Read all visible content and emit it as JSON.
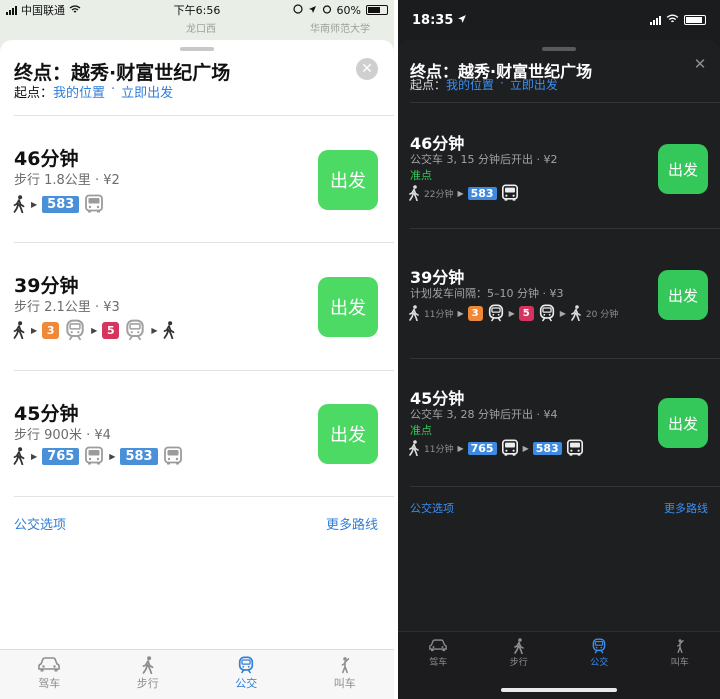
{
  "colors": {
    "accent": "#2f7ed8",
    "go": "#4cd964",
    "bus": "#4a90d9",
    "line3": "#f0883a",
    "line5": "#d6345f",
    "ontime": "#35c759"
  },
  "left": {
    "status": {
      "carrier": "中国联通",
      "time": "下午6:56",
      "battery": "60%"
    },
    "map_labels": [
      "龙口西",
      "华南师范大学"
    ],
    "header": {
      "destination": "终点：越秀·财富世纪广场",
      "origin_label": "起点：",
      "origin_value": "我的位置",
      "sep": "·",
      "depart": "立即出发"
    },
    "routes": [
      {
        "duration": "46分钟",
        "info": "步行 1.8公里 · ¥2",
        "bus1": "583",
        "go": "出发"
      },
      {
        "duration": "39分钟",
        "info": "步行 2.1公里 · ¥3",
        "line1": "3",
        "line2": "5",
        "go": "出发"
      },
      {
        "duration": "45分钟",
        "info": "步行 900米 · ¥4",
        "bus1": "765",
        "bus2": "583",
        "go": "出发"
      }
    ],
    "footer": {
      "options": "公交选项",
      "more": "更多路线"
    },
    "tabs": [
      "驾车",
      "步行",
      "公交",
      "叫车"
    ]
  },
  "right": {
    "status": {
      "time": "18:35"
    },
    "header": {
      "destination": "终点：越秀·财富世纪广场",
      "origin_label": "起点：",
      "origin_value": "我的位置",
      "sep": "·",
      "depart": "立即出发"
    },
    "routes": [
      {
        "duration": "46分钟",
        "info": "公交车 3, 15 分钟后开出 · ¥2",
        "ontime": "准点",
        "walk1": "22分钟",
        "bus1": "583",
        "go": "出发"
      },
      {
        "duration": "39分钟",
        "info": "计划发车间隔：5–10 分钟 · ¥3",
        "walk1": "11分钟",
        "line1": "3",
        "line2": "5",
        "walk2": "20 分钟",
        "go": "出发"
      },
      {
        "duration": "45分钟",
        "info": "公交车 3, 28 分钟后开出 · ¥4",
        "ontime": "准点",
        "walk1": "11分钟",
        "bus1": "765",
        "bus2": "583",
        "go": "出发"
      }
    ],
    "footer": {
      "options": "公交选项",
      "more": "更多路线"
    },
    "tabs": [
      "驾车",
      "步行",
      "公交",
      "叫车"
    ]
  }
}
